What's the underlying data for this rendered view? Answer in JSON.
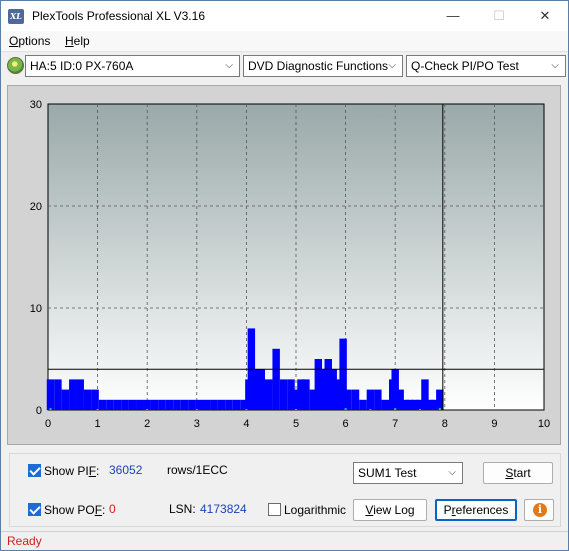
{
  "window": {
    "title": "PlexTools Professional XL V3.16",
    "icon_name": "plextools-icon",
    "controls": {
      "minimize": "—",
      "maximize": "☐",
      "close": "✕"
    }
  },
  "menu": {
    "options": {
      "mnemonic": "O",
      "rest": "ptions"
    },
    "help": {
      "mnemonic": "H",
      "rest": "elp"
    }
  },
  "toolbar": {
    "drive": "HA:5 ID:0  PX-760A",
    "function": "DVD Diagnostic Functions",
    "test": "Q-Check PI/PO Test",
    "arrow": "⌵"
  },
  "chart_data": {
    "type": "bar",
    "title": "",
    "xlabel": "",
    "ylabel": "",
    "xlim": [
      0,
      10
    ],
    "ylim": [
      0,
      30
    ],
    "x_ticks": [
      "0",
      "1",
      "2",
      "3",
      "4",
      "5",
      "6",
      "7",
      "8",
      "9",
      "10"
    ],
    "y_ticks": [
      "0",
      "10",
      "20",
      "30"
    ],
    "grid": true,
    "threshold_line": 4,
    "progress_marker_x": 7.96,
    "colors": {
      "pif": "#0000ff",
      "pof": "#00c0c0",
      "plot_top": "#9aa9a9",
      "plot_bottom": "#ffffff"
    },
    "series": [
      {
        "name": "PIF",
        "x": [
          0.05,
          0.2,
          0.35,
          0.5,
          0.65,
          0.8,
          0.95,
          1.1,
          1.25,
          1.4,
          1.55,
          1.7,
          1.85,
          2.0,
          2.15,
          2.3,
          2.45,
          2.6,
          2.75,
          2.9,
          3.05,
          3.2,
          3.35,
          3.5,
          3.65,
          3.8,
          3.95,
          4.05,
          4.1,
          4.2,
          4.3,
          4.45,
          4.6,
          4.75,
          4.9,
          5.0,
          5.1,
          5.2,
          5.35,
          5.45,
          5.55,
          5.65,
          5.75,
          5.85,
          5.95,
          6.05,
          6.2,
          6.35,
          6.5,
          6.65,
          6.8,
          6.95,
          7.0,
          7.1,
          7.2,
          7.3,
          7.4,
          7.5,
          7.6,
          7.7,
          7.8,
          7.9
        ],
        "values": [
          3,
          3,
          2,
          3,
          3,
          2,
          2,
          1,
          1,
          1,
          1,
          1,
          1,
          1,
          1,
          1,
          1,
          1,
          1,
          1,
          1,
          1,
          1,
          1,
          1,
          1,
          1,
          3,
          8,
          4,
          4,
          3,
          6,
          3,
          3,
          2,
          3,
          3,
          2,
          5,
          4,
          5,
          4,
          3,
          7,
          2,
          2,
          1,
          2,
          2,
          1,
          3,
          4,
          2,
          1,
          1,
          1,
          1,
          3,
          1,
          1,
          2
        ]
      },
      {
        "name": "POF",
        "x": [
          0.05,
          1,
          2,
          3,
          4,
          5,
          6,
          6.5,
          7,
          7.5,
          7.9
        ],
        "values": [
          0.2,
          0.1,
          0.1,
          0.1,
          0.1,
          0.1,
          0.2,
          0.1,
          0.2,
          0.1,
          0.2
        ]
      }
    ]
  },
  "bottom": {
    "show_pif": {
      "label_pre": "Show PI",
      "mnemonic": "F",
      "label_post": ":",
      "checked": true,
      "value": "36052",
      "unit": "rows/1ECC"
    },
    "show_pof": {
      "label_pre": "Show PO",
      "mnemonic": "F",
      "label_post": ":",
      "checked": true,
      "value": "0"
    },
    "lsn": {
      "label": "LSN:",
      "value": "4173824"
    },
    "logarithmic": {
      "label": "Logarithmic",
      "checked": false
    },
    "sum_select": "SUM1 Test",
    "start": {
      "mnemonic": "S",
      "rest": "tart"
    },
    "view_log": {
      "mnemonic": "V",
      "rest": "iew Log"
    },
    "preferences": {
      "pre": "P",
      "mnemonic": "r",
      "rest": "eferences"
    },
    "info_glyph": "i"
  },
  "status": {
    "text": "Ready"
  }
}
